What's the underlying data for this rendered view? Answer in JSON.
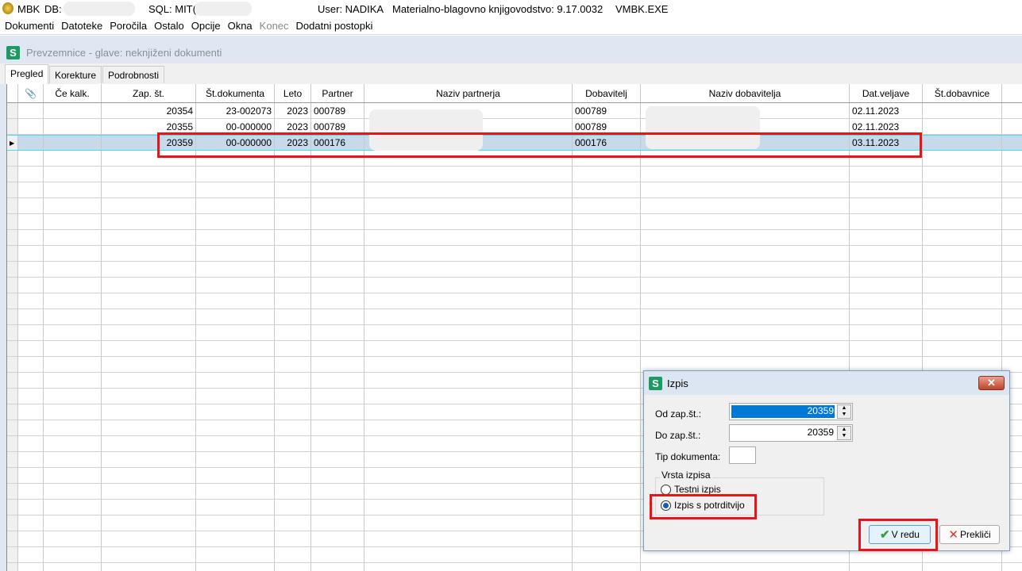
{
  "titlebar": {
    "app": "MBK",
    "db_label": "DB:",
    "sql_label": "SQL: MIT(",
    "user": "User: NADIKA",
    "product": "Materialno-blagovno knjigovodstvo: 9.17.0032",
    "exe": "VMBK.EXE"
  },
  "menu": [
    "Dokumenti",
    "Datoteke",
    "Poročila",
    "Ostalo",
    "Opcije",
    "Okna",
    "Konec",
    "Dodatni postopki"
  ],
  "window": {
    "title": "Prevzemnice - glave: neknjiženi dokumenti",
    "icon": "S"
  },
  "tabs": [
    "Pregled",
    "Korekture",
    "Podrobnosti"
  ],
  "grid": {
    "columns": [
      "",
      "Če kalk.",
      "Zap. št.",
      "Št.dokumenta",
      "Leto",
      "Partner",
      "Naziv partnerja",
      "Dobavitelj",
      "Naziv dobavitelja",
      "Dat.veljave",
      "Št.dobavnice"
    ],
    "rows": [
      {
        "zap": "20354",
        "dok": "23-002073",
        "leto": "2023",
        "partner": "000789",
        "dobavitelj": "000789",
        "datum": "02.11.2023"
      },
      {
        "zap": "20355",
        "dok": "00-000000",
        "leto": "2023",
        "partner": "000789",
        "dobavitelj": "000789",
        "datum": "02.11.2023"
      },
      {
        "zap": "20359",
        "dok": "00-000000",
        "leto": "2023",
        "partner": "000176",
        "dobavitelj": "000176",
        "datum": "03.11.2023"
      }
    ]
  },
  "dialog": {
    "title": "Izpis",
    "icon": "S",
    "close": "✕",
    "od_label": "Od zap.št.:",
    "od_value": "20359",
    "do_label": "Do zap.št.:",
    "do_value": "20359",
    "tip_label": "Tip dokumenta:",
    "tip_value": "",
    "group": "Vrsta izpisa",
    "option1": "Testni izpis",
    "option2": "Izpis s potrditvijo",
    "selected": "Izpis s potrditvijo",
    "ok": "V redu",
    "cancel": "Prekliči"
  }
}
